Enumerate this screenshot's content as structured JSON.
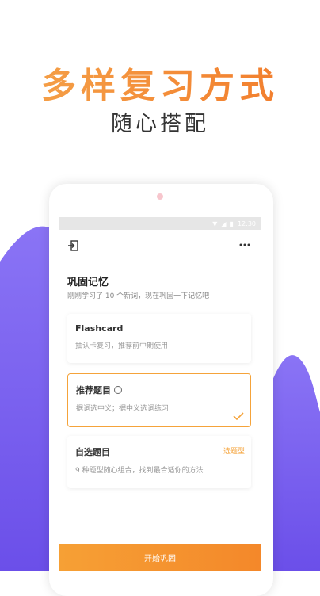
{
  "promo": {
    "headline": "多样复习方式",
    "subheadline": "随心搭配"
  },
  "statusbar": {
    "time": "12:30"
  },
  "screen": {
    "title": "巩固记忆",
    "description": "刚刚学习了 10 个新词，现在巩固一下记忆吧",
    "options": [
      {
        "title": "Flashcard",
        "desc": "抽认卡复习，推荐前中期使用"
      },
      {
        "title": "推荐题目",
        "desc": "据词选中义；据中义选词练习"
      },
      {
        "title": "自选题目",
        "desc": "9 种题型随心组合，找到最合适你的方法",
        "tag": "选题型"
      }
    ],
    "start_button": "开始巩固"
  },
  "colors": {
    "accent": "#f5a33a",
    "wave": "#7b63f0"
  }
}
